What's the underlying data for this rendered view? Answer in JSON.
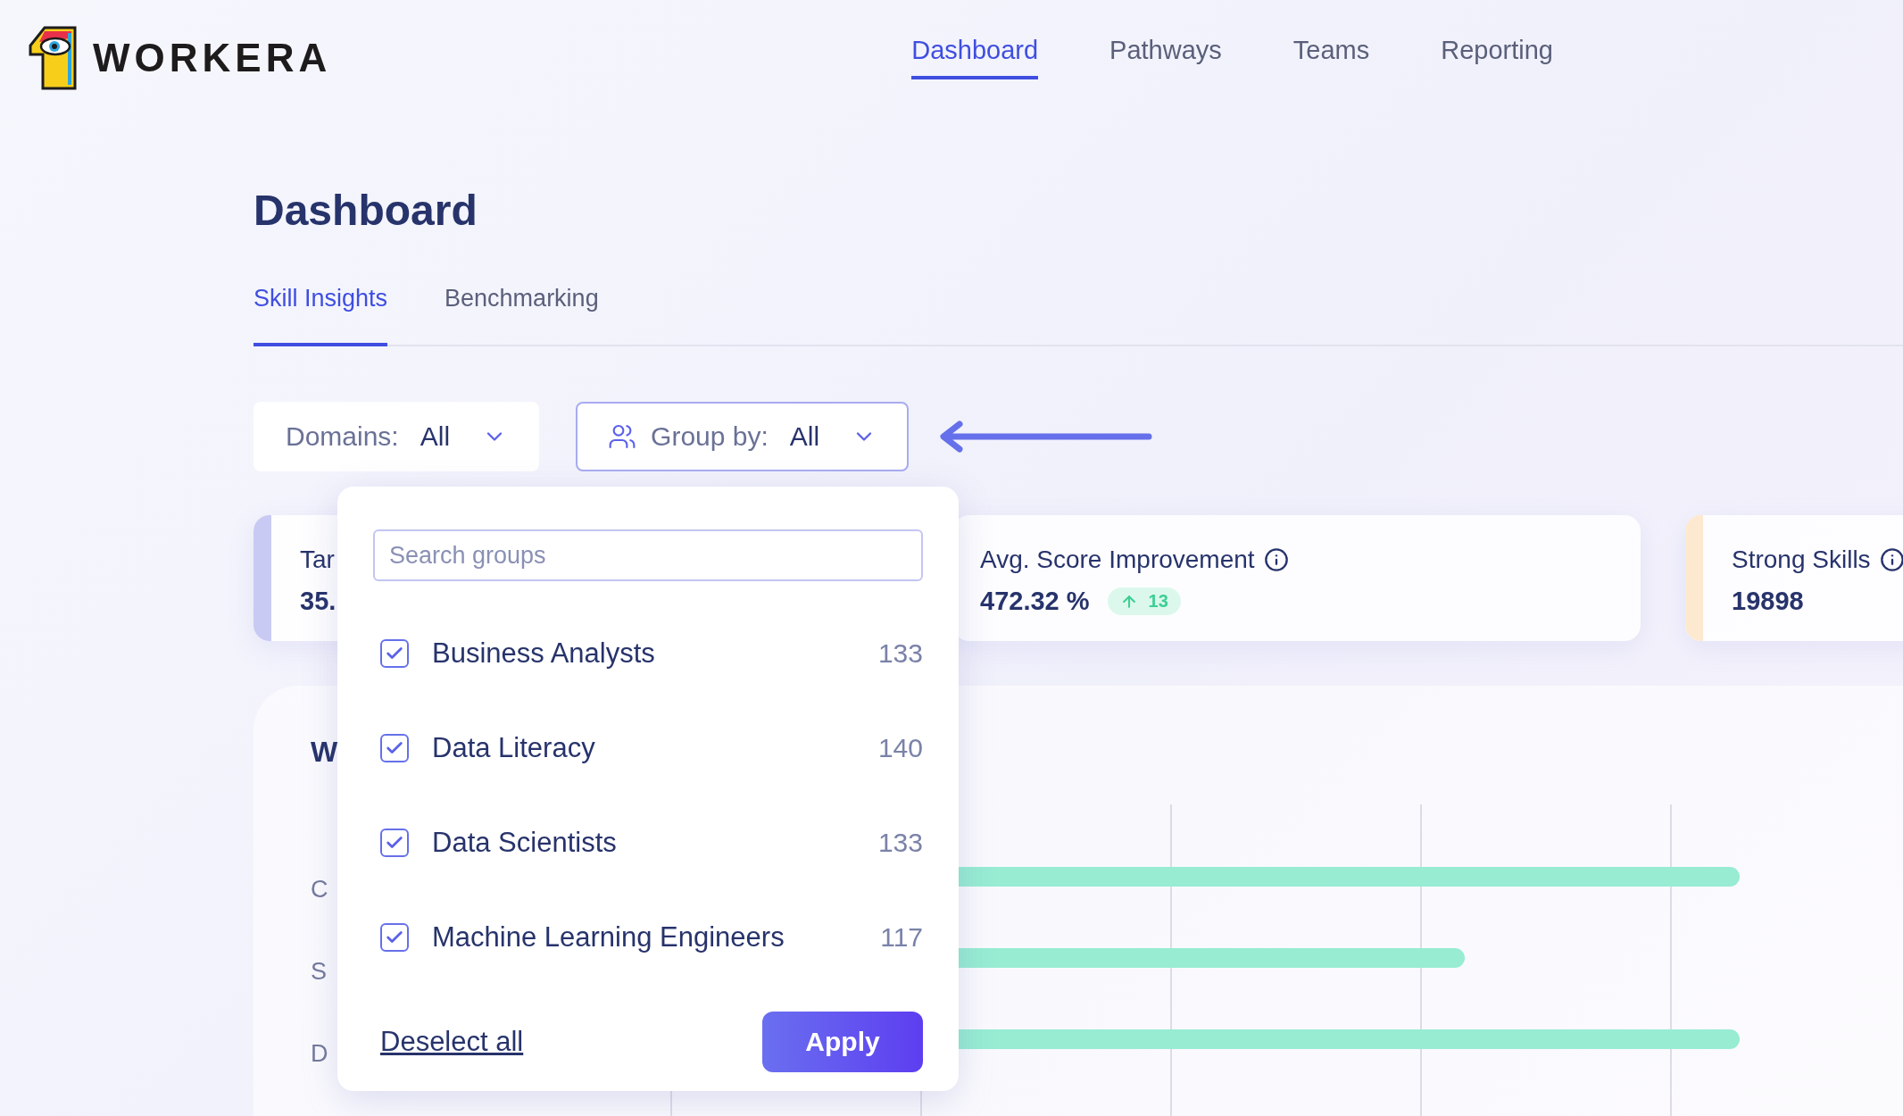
{
  "brand": {
    "name": "WORKERA"
  },
  "nav": [
    {
      "label": "Dashboard",
      "selected": true
    },
    {
      "label": "Pathways",
      "selected": false
    },
    {
      "label": "Teams",
      "selected": false
    },
    {
      "label": "Reporting",
      "selected": false
    }
  ],
  "page_title": "Dashboard",
  "tabs": [
    {
      "label": "Skill Insights",
      "selected": true
    },
    {
      "label": "Benchmarking",
      "selected": false
    }
  ],
  "filters": [
    {
      "kind": "plain",
      "label": "Domains:",
      "value": "All",
      "open": false
    },
    {
      "kind": "group",
      "label": "Group by:",
      "value": "All",
      "open": true
    }
  ],
  "dropdown": {
    "search_placeholder": "Search groups",
    "items": [
      {
        "label": "Business Analysts",
        "count": "133",
        "checked": true
      },
      {
        "label": "Data Literacy",
        "count": "140",
        "checked": true
      },
      {
        "label": "Data Scientists",
        "count": "133",
        "checked": true
      },
      {
        "label": "Machine Learning Engineers",
        "count": "117",
        "checked": true
      }
    ],
    "deselect_label": "Deselect all",
    "apply_label": "Apply"
  },
  "stats": [
    {
      "label": "Tar",
      "value": "35.",
      "color": "#c9caf3"
    },
    {
      "label": "Avg. Score Improvement",
      "value": "472.32 %",
      "change": "13",
      "info": true
    },
    {
      "label": "Strong Skills",
      "value": "19898",
      "color": "#fde9cf",
      "info": true
    }
  ],
  "chart_card": {
    "title": "W",
    "labels": [
      "C",
      "S",
      "D"
    ]
  }
}
